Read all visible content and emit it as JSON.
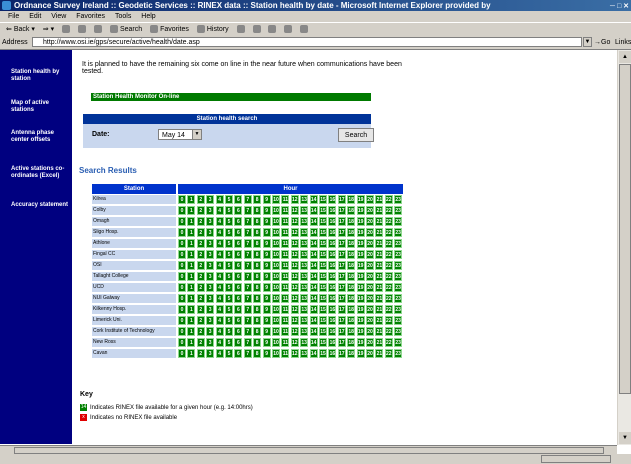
{
  "window": {
    "title": "Ordnance Survey Ireland :: Geodetic Services :: RINEX data :: Station health by date - Microsoft Internet Explorer provided by"
  },
  "menu": [
    "File",
    "Edit",
    "View",
    "Favorites",
    "Tools",
    "Help"
  ],
  "toolbar": {
    "back": "Back",
    "search": "Search",
    "favorites": "Favorites",
    "history": "History"
  },
  "address": {
    "label": "Address",
    "url": "http://www.osi.ie/gps/secure/active/health/date.asp",
    "go": "Go",
    "links": "Links"
  },
  "nav": [
    "Station health by station",
    "Map of active stations",
    "Antenna phase center offsets",
    "Active stations co-ordinates (Excel)",
    "Accuracy statement"
  ],
  "intro": "It is planned to have the remaining six come on line in the near future when communications have been tested.",
  "banner": "Station Health Monitor On-line",
  "search": {
    "header": "Station health search",
    "date_label": "Date:",
    "date_value": "May 14",
    "button": "Search"
  },
  "results_title": "Search Results",
  "table": {
    "col_station": "Station",
    "col_hour": "Hour",
    "hours": [
      "0",
      "1",
      "2",
      "3",
      "4",
      "5",
      "6",
      "7",
      "8",
      "9",
      "10",
      "11",
      "12",
      "13",
      "14",
      "15",
      "16",
      "17",
      "18",
      "19",
      "20",
      "21",
      "22",
      "23"
    ],
    "stations": [
      "Kilrea",
      "Colby",
      "Omagh",
      "Sligo Hosp.",
      "Athlone",
      "Fingal CC",
      "OSI",
      "Tallaght College",
      "UCD",
      "NUI Galway",
      "Kilkenny Hosp.",
      "Limerick Uni.",
      "Cork Institute of Technology",
      "New Ross",
      "Cavan"
    ]
  },
  "key": {
    "title": "Key",
    "available_swatch": "14",
    "available_text": "Indicates RINEX file available for a given hour (e.g. 14:00hrs)",
    "missing_swatch": "x",
    "missing_text": "Indicates no RINEX file available"
  },
  "colors": {
    "available": "#008000",
    "missing": "#e00000",
    "header": "#0033cc",
    "nav_bg": "#000080"
  }
}
